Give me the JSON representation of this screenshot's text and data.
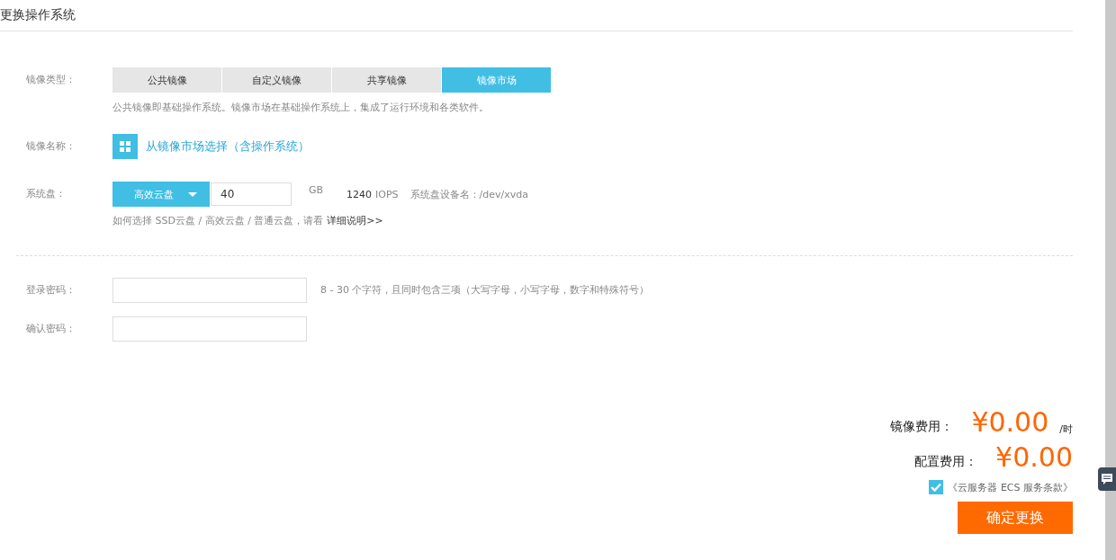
{
  "title": "更换操作系统",
  "image_type": {
    "label": "镜像类型：",
    "tabs": [
      {
        "label": "公共镜像",
        "selected": false
      },
      {
        "label": "自定义镜像",
        "selected": false
      },
      {
        "label": "共享镜像",
        "selected": false
      },
      {
        "label": "镜像市场",
        "selected": true
      }
    ],
    "hint": "公共镜像即基础操作系统。镜像市场在基础操作系统上，集成了运行环境和各类软件。"
  },
  "image_name": {
    "label": "镜像名称：",
    "link": "从镜像市场选择（含操作系统）"
  },
  "system_disk": {
    "label": "系统盘：",
    "disk_type": "高效云盘",
    "size": "40",
    "unit": "GB",
    "iops_value": "1240",
    "iops_unit": "IOPS",
    "device": "系统盘设备名：/dev/xvda",
    "help_text": "如何选择 SSD云盘 / 高效云盘 / 普通云盘，请看",
    "help_link": "详细说明>>"
  },
  "passwords": [
    {
      "label": "登录密码：",
      "hint": "8 - 30 个字符，且同时包含三项（大写字母，小写字母，数字和特殊符号）"
    },
    {
      "label": "确认密码："
    }
  ],
  "fees": [
    {
      "label": "镜像费用：",
      "amount": "¥0.00",
      "unit": "/时"
    },
    {
      "label": "配置费用：",
      "amount": "¥0.00"
    }
  ],
  "agreement": {
    "text": "《云服务器 ECS 服务条款》",
    "checked": true
  },
  "confirm_button": "确定更换"
}
